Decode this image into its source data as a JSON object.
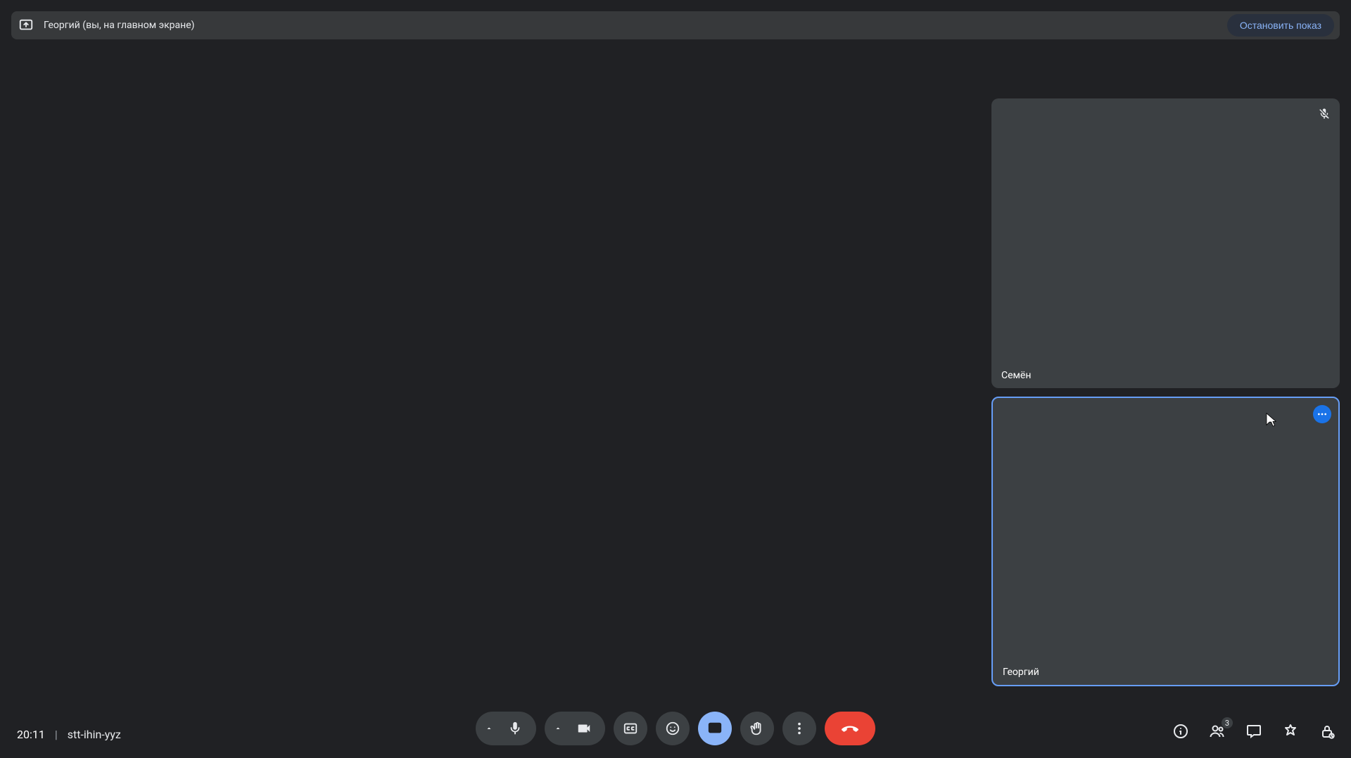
{
  "presenting": {
    "label": "Георгий (вы, на главном экране)",
    "stop_label": "Остановить показ"
  },
  "participants": [
    {
      "name": "Семён",
      "muted": true,
      "speaking": false
    },
    {
      "name": "Георгий",
      "muted": false,
      "speaking": true
    }
  ],
  "footer": {
    "time": "20:11",
    "meeting_code": "stt-ihin-yyz",
    "participant_count": "3"
  },
  "colors": {
    "bg": "#202124",
    "tile": "#3c4043",
    "accent": "#8ab4f8",
    "accent_strong": "#1a73e8",
    "danger": "#ea4335",
    "link": "#8ab4f8"
  },
  "icons": {
    "present": "present-to-all",
    "mic": "mic",
    "mic_off": "mic-off",
    "cam": "videocam",
    "cc": "closed-caption",
    "emoji": "emoji",
    "hand": "raise-hand",
    "more": "more-vert",
    "hangup": "call-end",
    "info": "info",
    "people": "people",
    "chat": "chat",
    "activities": "activities",
    "lock": "host-controls"
  }
}
